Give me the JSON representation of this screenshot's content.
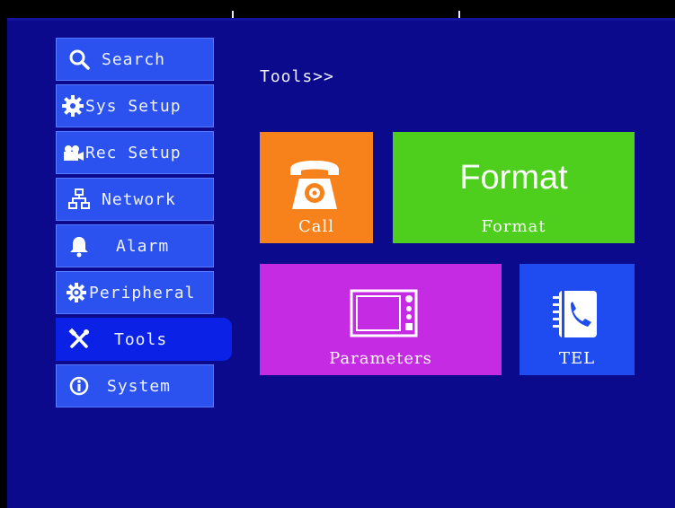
{
  "menu": {
    "items": [
      {
        "label": "Search",
        "icon": "search-icon"
      },
      {
        "label": "Sys Setup",
        "icon": "gear-icon"
      },
      {
        "label": "Rec Setup",
        "icon": "video-camera-icon"
      },
      {
        "label": "Network",
        "icon": "network-icon"
      },
      {
        "label": "Alarm",
        "icon": "bell-icon"
      },
      {
        "label": "Peripheral",
        "icon": "peripheral-gear-icon"
      },
      {
        "label": "Tools",
        "icon": "tools-icon",
        "active": true
      },
      {
        "label": "System",
        "icon": "info-icon"
      }
    ]
  },
  "breadcrumb": "Tools>>",
  "tiles": {
    "call": {
      "label": "Call",
      "color": "#f7821c",
      "icon": "telephone-icon"
    },
    "format": {
      "title": "Format",
      "label": "Format",
      "color": "#4fcf1d"
    },
    "parameters": {
      "label": "Parameters",
      "color": "#c62be4",
      "icon": "monitor-icon"
    },
    "tel": {
      "label": "TEL",
      "color": "#1f4cf0",
      "icon": "phonebook-icon"
    }
  },
  "colors": {
    "background": "#0c0a8c",
    "menu_item": "#2b52ef",
    "menu_active": "#0b22e6"
  }
}
